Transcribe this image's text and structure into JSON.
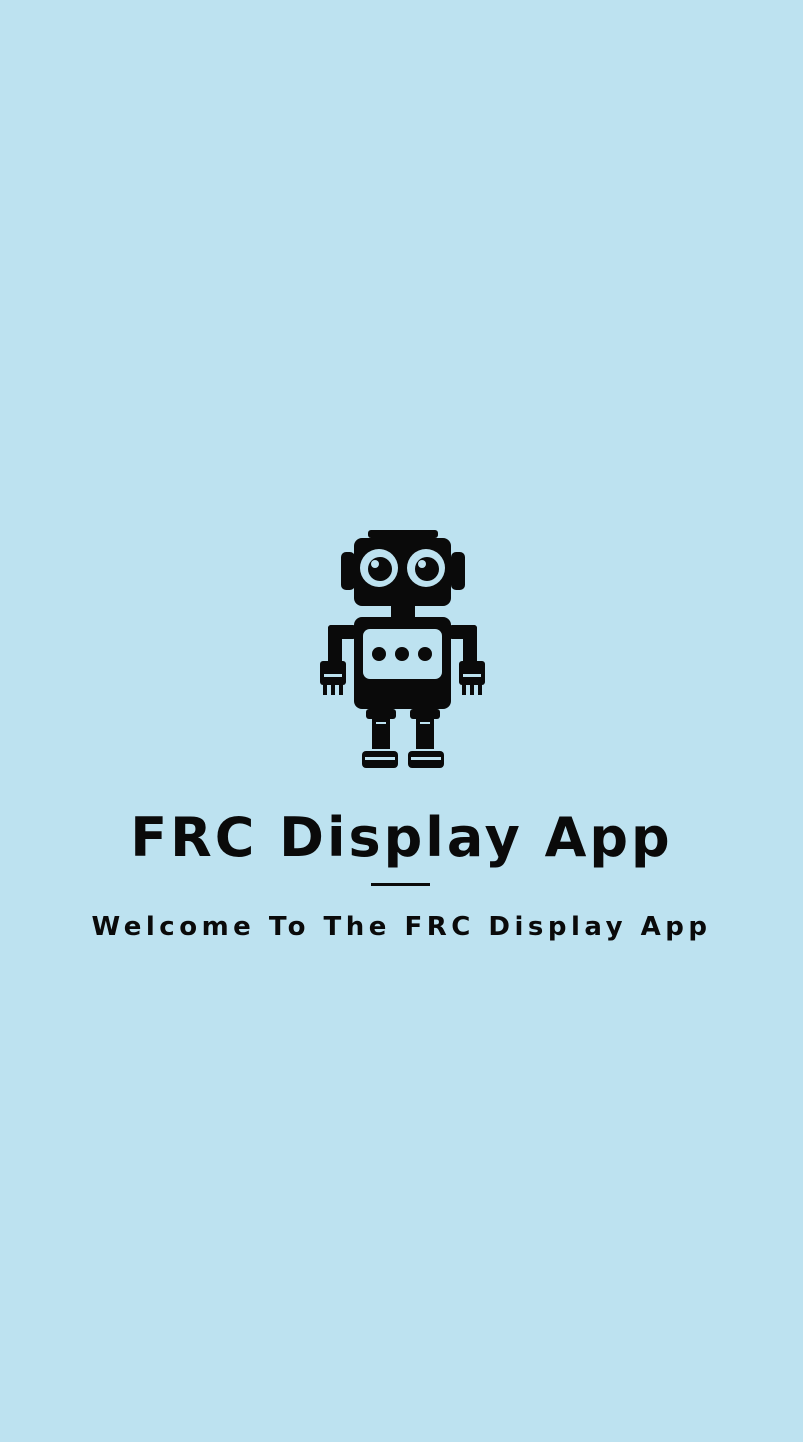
{
  "colors": {
    "background": "#bde2f0",
    "foreground": "#0a0a0a"
  },
  "splash": {
    "logo_icon": "robot-icon",
    "title": "FRC Display App",
    "subtitle": "Welcome To The FRC Display App"
  }
}
